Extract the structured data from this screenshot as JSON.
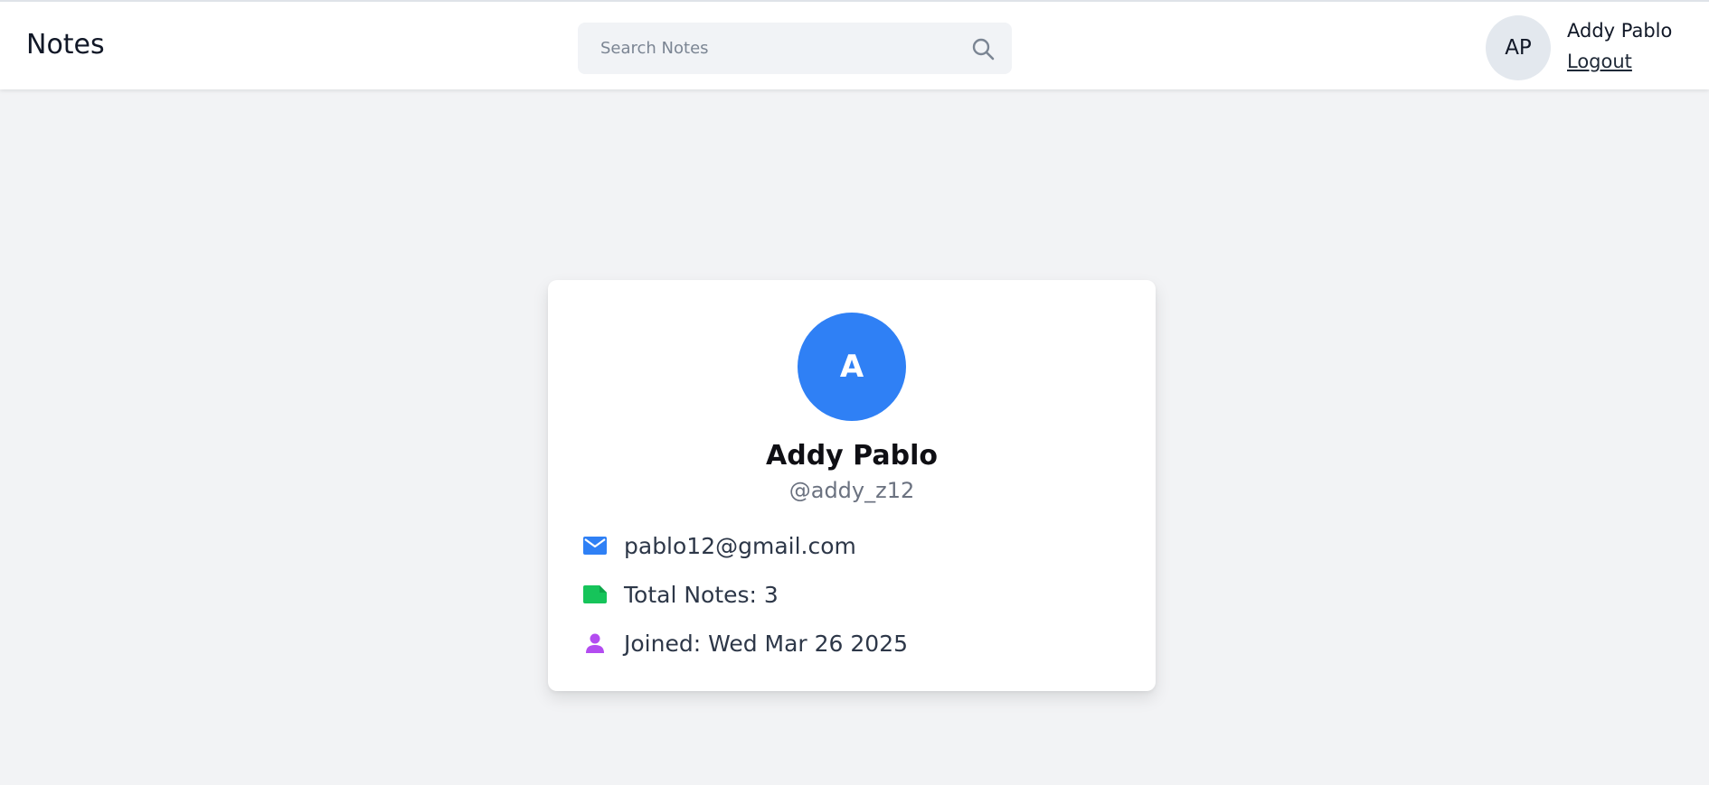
{
  "navbar": {
    "brand": "Notes",
    "search": {
      "placeholder": "Search Notes",
      "value": "",
      "icon": "search-icon"
    },
    "user": {
      "initials": "AP",
      "name": "Addy Pablo",
      "logout_label": "Logout"
    }
  },
  "profile": {
    "avatar_letter": "A",
    "name": "Addy Pablo",
    "handle": "@addy_z12",
    "details": {
      "email": "pablo12@gmail.com",
      "total_notes": "Total Notes: 3",
      "joined": "Joined: Wed Mar 26 2025"
    }
  },
  "colors": {
    "accent_blue": "#2f80f5",
    "notes_green": "#16c45a",
    "user_purple": "#b34cf0",
    "page_bg": "#f2f3f5"
  }
}
